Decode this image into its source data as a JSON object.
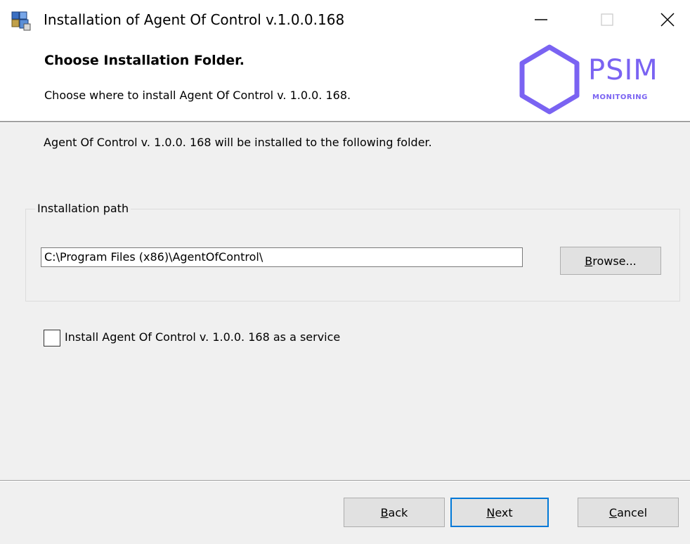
{
  "window": {
    "title": "Installation of Agent Of Control v.1.0.0.168",
    "icon": "installer-icon",
    "controls": [
      "minimize-icon",
      "maximize-icon",
      "close-icon"
    ]
  },
  "banner": {
    "title": "Choose Installation Folder.",
    "subtitle": "Choose where to install Agent Of Control v. 1.0.0. 168.",
    "logo_word": "PSIM",
    "logo_tag": "MONITORING",
    "logo_color": "#7a63f2"
  },
  "body": {
    "description": "Agent Of Control v. 1.0.0. 168 will be installed to the following folder.",
    "group_label": "Installation path",
    "path_value": "C:\\Program Files (x86)\\AgentOfControl\\",
    "browse_accel": "B",
    "browse_rest": "rowse...",
    "service_checkbox_label": "Install Agent Of Control v. 1.0.0. 168 as a service",
    "service_checked": false
  },
  "footer": {
    "back_accel": "B",
    "back_rest": "ack",
    "next_accel": "N",
    "next_rest": "ext",
    "cancel_accel": "C",
    "cancel_rest": "ancel"
  },
  "colors": {
    "focus_border": "#0078d7",
    "dialog_bg": "#f0f0f0"
  }
}
